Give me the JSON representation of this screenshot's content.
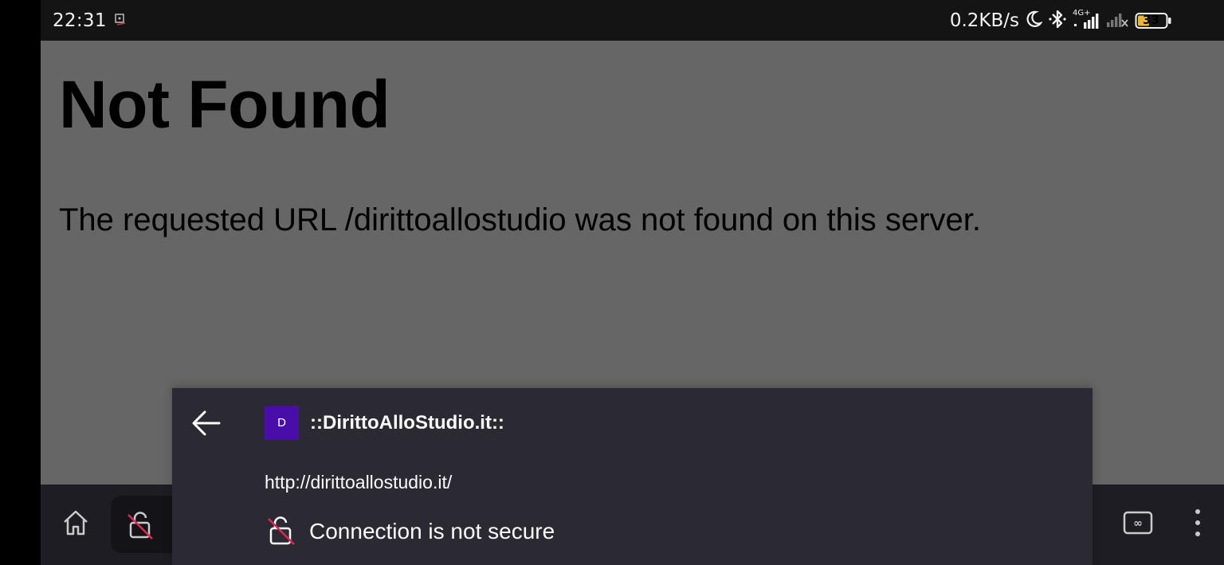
{
  "status_bar": {
    "time": "22:31",
    "net_speed": "0.2KB/s",
    "network_type": "4G+",
    "battery_level": "33"
  },
  "page": {
    "title": "Not Found",
    "message": "The requested URL /dirittoallostudio was not found on this server."
  },
  "site_info_sheet": {
    "favicon_letter": "D",
    "site_name": "::DirittoAlloStudio.it::",
    "url": "http://dirittoallostudio.it/",
    "connection_status": "Connection is not secure"
  },
  "colors": {
    "page_bg": "#666666",
    "sheet_bg": "#2b2a33",
    "favicon_bg": "#4a0ea8",
    "insecure_slash": "#e22850"
  },
  "icons": [
    "back-arrow-icon",
    "home-icon",
    "insecure-lock-icon",
    "tabs-icon",
    "menu-icon",
    "moon-icon",
    "bluetooth-icon",
    "battery-icon"
  ]
}
